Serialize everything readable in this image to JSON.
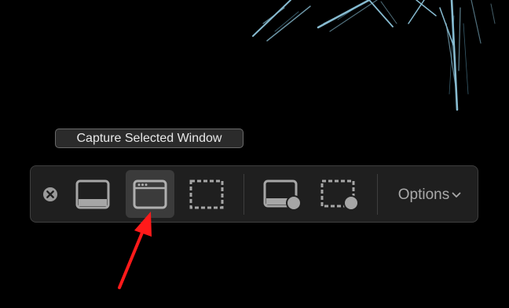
{
  "tooltip": {
    "text": "Capture Selected Window"
  },
  "toolbar": {
    "options_label": "Options",
    "selected_tool": "capture-selected-window",
    "icons": {
      "close": "close-icon",
      "capture_entire_screen": "entire-screen-icon",
      "capture_selected_window": "window-icon",
      "capture_selected_portion": "dashed-selection-icon",
      "record_entire_screen": "record-screen-icon",
      "record_selected_portion": "record-selection-icon",
      "options_chevron": "chevron-down-icon"
    }
  },
  "annotation": {
    "arrow_color": "#ff1a1a",
    "target": "capture-selected-window-button"
  },
  "colors": {
    "background": "#000000",
    "toolbar_bg": "#1f1f1f",
    "selected_bg": "#3b3b3b",
    "icon": "#a6a6a6",
    "wallpaper_accent": "#8fd3f0"
  }
}
